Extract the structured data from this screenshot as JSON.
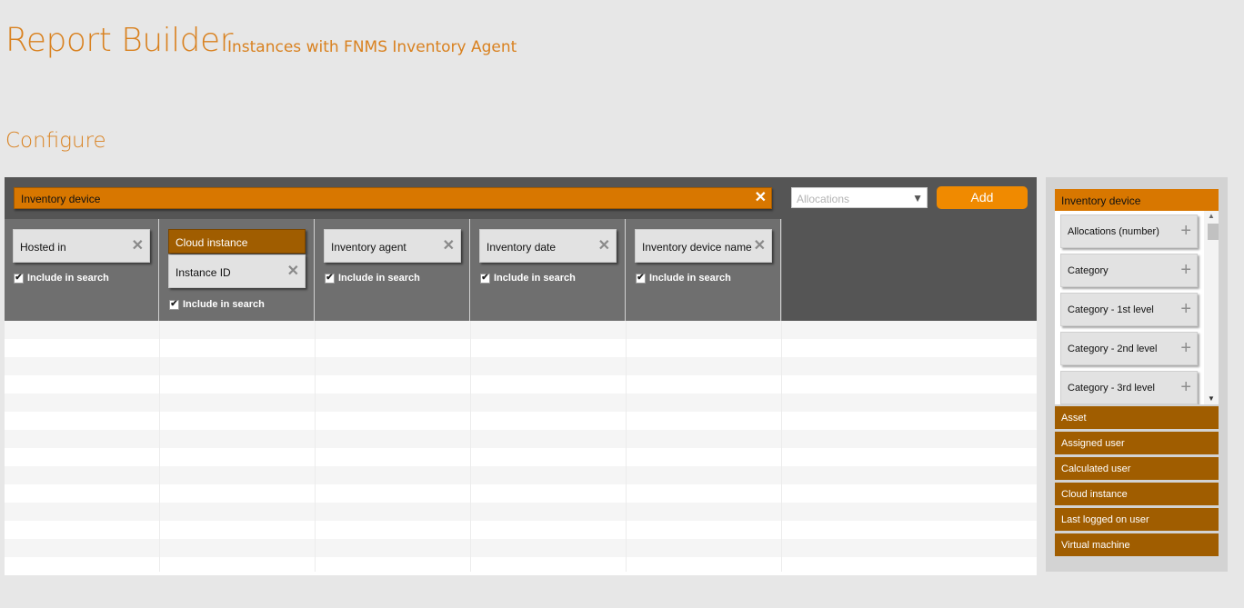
{
  "header": {
    "title": "Report Builder",
    "subtitle": "Instances with FNMS Inventory Agent"
  },
  "section": {
    "title": "Configure"
  },
  "builder": {
    "root_object": "Inventory device",
    "columns": [
      {
        "field": "Hosted in",
        "parent": null,
        "include_label": "Include in search",
        "include_checked": true
      },
      {
        "field": "Instance ID",
        "parent": "Cloud instance",
        "include_label": "Include in search",
        "include_checked": true
      },
      {
        "field": "Inventory agent",
        "parent": null,
        "include_label": "Include in search",
        "include_checked": true
      },
      {
        "field": "Inventory date",
        "parent": null,
        "include_label": "Include in search",
        "include_checked": true
      },
      {
        "field": "Inventory device name",
        "parent": null,
        "include_label": "Include in search",
        "include_checked": true
      }
    ],
    "add_select": {
      "placeholder": "Allocations"
    },
    "add_button": "Add"
  },
  "panel": {
    "header": "Inventory device",
    "properties": [
      "Allocations (number)",
      "Category",
      "Category - 1st level",
      "Category - 2nd level",
      "Category - 3rd level"
    ],
    "related_objects": [
      "Asset",
      "Assigned user",
      "Calculated user",
      "Cloud instance",
      "Last logged on user",
      "Virtual machine"
    ]
  },
  "icons": {
    "remove": "close-icon",
    "add_property": "plus-icon",
    "dropdown": "chevron-down-icon"
  },
  "colors": {
    "accent": "#d87700",
    "accent_dark": "#a05d00",
    "title": "#d9811f",
    "button": "#f08a00"
  }
}
